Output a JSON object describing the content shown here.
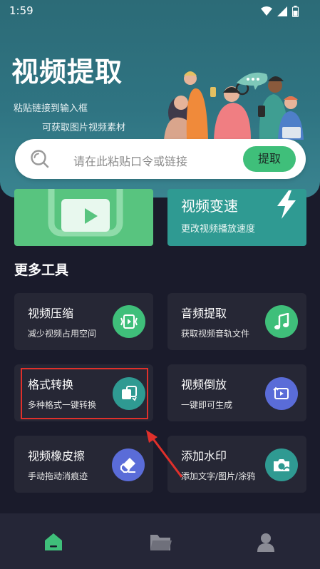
{
  "status_bar": {
    "time": "1:59"
  },
  "header": {
    "title": "视频提取",
    "subtitle_1": "粘贴链接到输入框",
    "subtitle_2": "可获取图片视频素材"
  },
  "search": {
    "placeholder": "请在此粘贴口令或链接",
    "button_label": "提取"
  },
  "feature_cards": [
    {
      "icon": "video-play-icon",
      "color": "#58c47f"
    },
    {
      "title": "视频变速",
      "desc": "更改视频播放速度",
      "icon": "lightning-icon",
      "color": "#2f9a92"
    }
  ],
  "more_tools": {
    "title": "更多工具",
    "items": [
      {
        "name": "视频压缩",
        "desc": "减少视频占用空间",
        "icon": "video-compress-icon",
        "color": "#3fbf7a"
      },
      {
        "name": "音频提取",
        "desc": "获取视频音轨文件",
        "icon": "music-note-icon",
        "color": "#3fbf7a"
      },
      {
        "name": "格式转换",
        "desc": "多种格式一键转换",
        "icon": "format-convert-icon",
        "color": "#2f9a92"
      },
      {
        "name": "视频倒放",
        "desc": "一键即可生成",
        "icon": "reverse-play-icon",
        "color": "#5a6cd8"
      },
      {
        "name": "视频橡皮擦",
        "desc": "手动拖动消痕迹",
        "icon": "eraser-icon",
        "color": "#5a6cd8"
      },
      {
        "name": "添加水印",
        "desc": "添加文字/图片/涂鸦",
        "icon": "camera-watermark-icon",
        "color": "#2f9a92"
      }
    ]
  },
  "bottom_nav": [
    {
      "icon": "home-icon",
      "active": true,
      "color": "#3fbf7a"
    },
    {
      "icon": "folder-icon",
      "active": false,
      "color": "#8a8b95"
    },
    {
      "icon": "profile-icon",
      "active": false,
      "color": "#8a8b95"
    }
  ]
}
